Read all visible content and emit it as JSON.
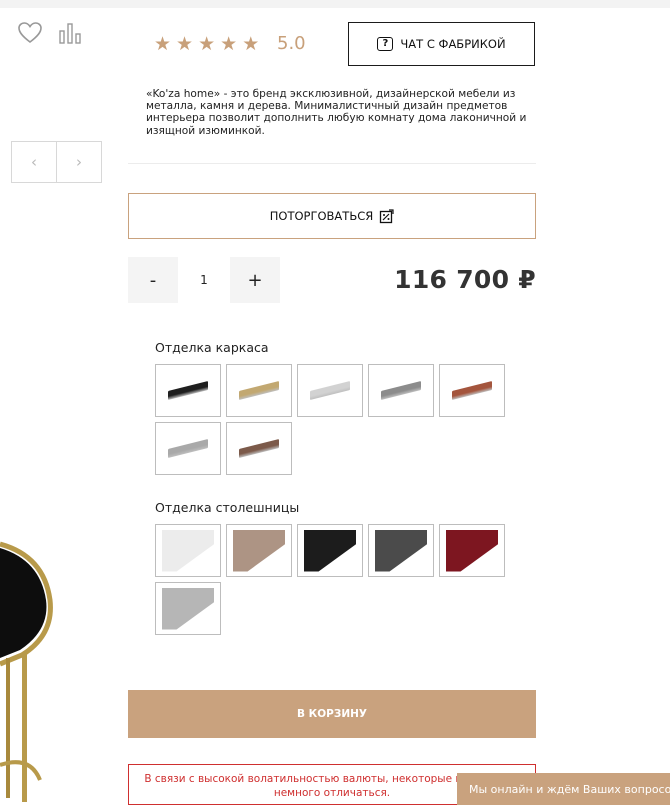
{
  "rating": {
    "stars": 5,
    "value": "5.0"
  },
  "buttons": {
    "chat": "ЧАТ С ФАБРИКОЙ",
    "haggle": "ПОТОРГОВАТЬСЯ",
    "cart": "В КОРЗИНУ"
  },
  "description": "«Ko'za home» - это бренд эксклюзивной, дизайнерской мебели из металла, камня и дерева. Минималистичный дизайн предметов интерьера позволит дополнить любую комнату дома лаконичной и изящной изюминкой.",
  "quantity": {
    "minus": "-",
    "value": "1",
    "plus": "+"
  },
  "price": "116 700 ₽",
  "frame_finish": {
    "title": "Отделка каркаса",
    "colors": [
      "#1f1f1f",
      "#c2a871",
      "#d2d2d2",
      "#8c8c8c",
      "#a4553d",
      "#a9a9a9",
      "#7c5a4a"
    ]
  },
  "top_finish": {
    "title": "Отделка столешницы",
    "colors": [
      "#ececec",
      "#ad9484",
      "#1c1c1c",
      "#4b4b4b",
      "#7d1620",
      "#b6b6b6"
    ]
  },
  "notice": "В связи с высокой волатильностью валюты, некоторые цены могут немного отличаться.",
  "chat_popup": "Мы онлайн и ждём Ваших вопросов",
  "icons": {
    "wishlist": "heart-icon",
    "compare": "compare-icon",
    "prev": "chevron-left-icon",
    "next": "chevron-right-icon"
  },
  "colors": {
    "accent": "#c9a27e",
    "alert": "#cf2f2f"
  }
}
